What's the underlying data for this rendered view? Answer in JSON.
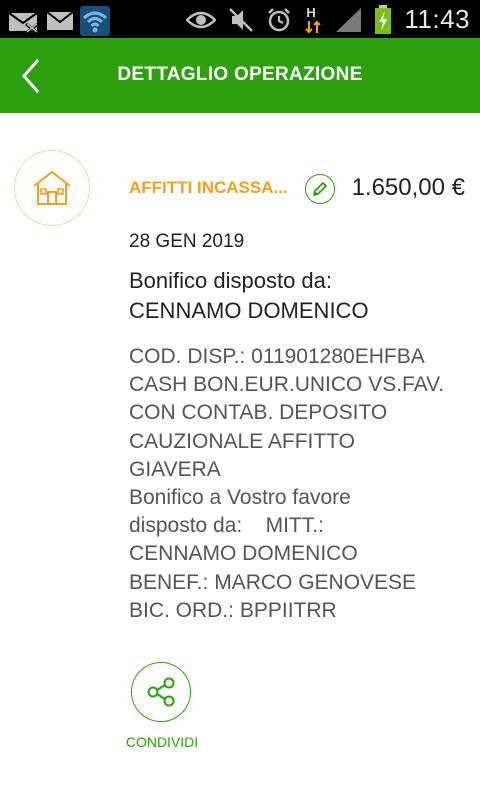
{
  "status_bar": {
    "time": "11:43",
    "network_label": "H",
    "icons": [
      "missed-mail-icon",
      "mail-icon",
      "wifi-icon",
      "eye-icon",
      "mute-icon",
      "alarm-icon",
      "network-h-icon",
      "signal-icon",
      "battery-charging-icon"
    ]
  },
  "header": {
    "title": "DETTAGLIO OPERAZIONE",
    "back_icon": "chevron-left-icon",
    "color": "#2ea00f"
  },
  "transaction": {
    "category_icon": "house-icon",
    "category": "AFFITTI INCASSA...",
    "category_color": "#f0a124",
    "edit_icon": "pencil-icon",
    "amount": "1.650,00 €",
    "date": "28 GEN 2019",
    "title_line1": "Bonifico disposto da:",
    "title_line2": "CENNAMO DOMENICO",
    "description": "COD. DISP.: 011901280EHFBA\nCASH BON.EUR.UNICO VS.FAV.\nCON CONTAB. DEPOSITO\nCAUZIONALE AFFITTO\nGIAVERA\nBonifico a Vostro favore\ndisposto da:    MITT.:\nCENNAMO DOMENICO\nBENEF.: MARCO GENOVESE\nBIC. ORD.: BPPIITRR"
  },
  "share": {
    "icon": "share-icon",
    "label": "CONDIVIDI"
  }
}
